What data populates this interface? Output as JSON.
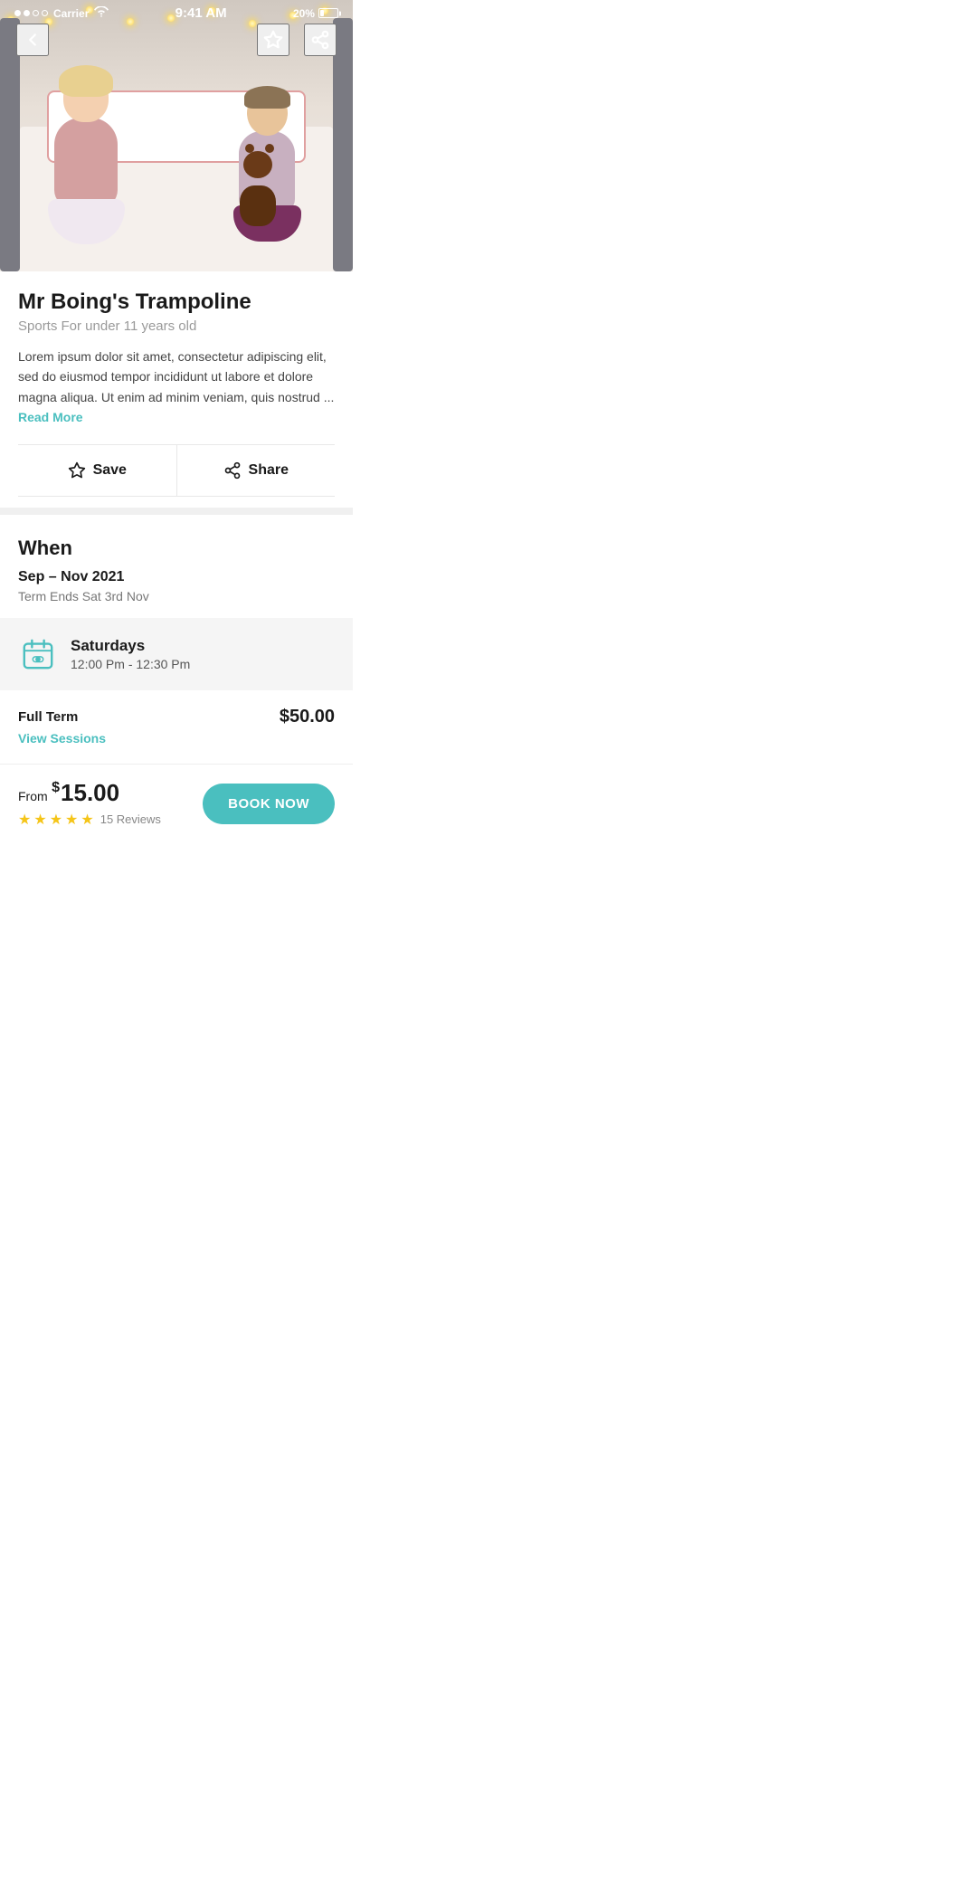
{
  "statusBar": {
    "carrier": "Carrier",
    "time": "9:41 AM",
    "battery": "20%"
  },
  "hero": {
    "backLabel": "back",
    "saveLabel": "save",
    "shareLabel": "share"
  },
  "event": {
    "title": "Mr Boing's Trampoline",
    "subtitle": "Sports For under 11 years old",
    "description": "Lorem ipsum dolor sit amet, consectetur adipiscing elit, sed do eiusmod tempor incididunt ut labore et dolore magna aliqua. Ut enim ad minim veniam, quis nostrud ...",
    "readMore": "Read More"
  },
  "actions": {
    "save": "Save",
    "share": "Share"
  },
  "when": {
    "sectionTitle": "When",
    "dateRange": "Sep – Nov 2021",
    "termEnd": "Term Ends Sat 3rd Nov"
  },
  "schedule": {
    "day": "Saturdays",
    "timeRange": "12:00 Pm - 12:30 Pm"
  },
  "pricing": {
    "label": "Full Term",
    "amount": "$50.00",
    "viewSessions": "View Sessions"
  },
  "bottomBar": {
    "fromLabel": "From",
    "currency": "$",
    "amount": "15.00",
    "starsCount": 5,
    "reviews": "15 Reviews",
    "bookNow": "BOOK NOW"
  },
  "lights": [
    8,
    50,
    95,
    140,
    185,
    230,
    275,
    320,
    355
  ]
}
